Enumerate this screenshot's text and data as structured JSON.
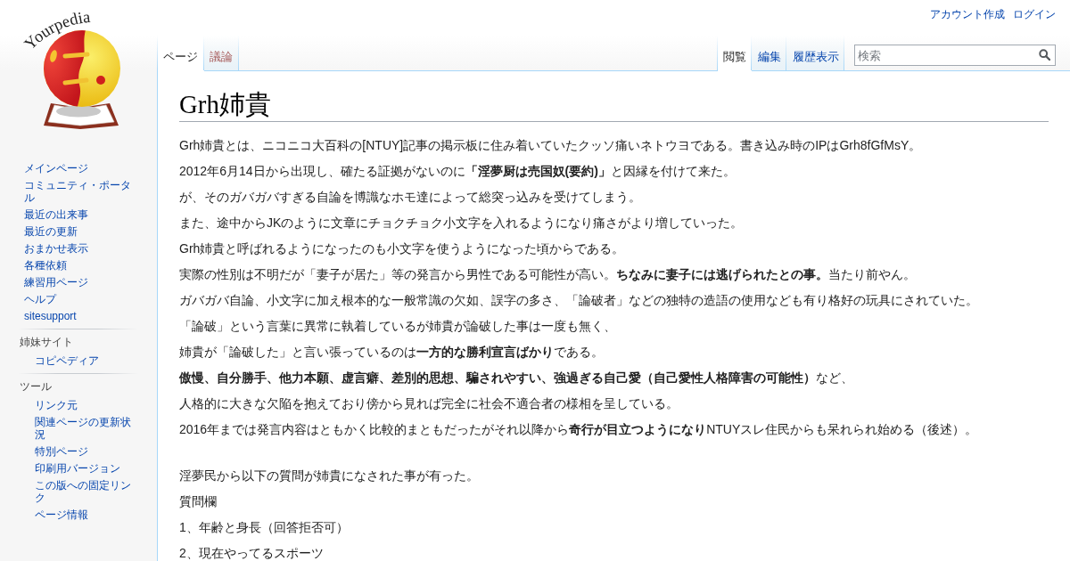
{
  "personal_links": [
    "アカウント作成",
    "ログイン"
  ],
  "logo": {
    "text": "Yourpedia"
  },
  "sidebar": {
    "navigation": [
      "メインページ",
      "コミュニティ・ポータル",
      "最近の出来事",
      "最近の更新",
      "おまかせ表示",
      "各種依頼",
      "練習用ページ",
      "ヘルプ",
      "sitesupport"
    ],
    "portals": [
      {
        "heading": "姉妹サイト",
        "items": [
          "コピペディア"
        ]
      },
      {
        "heading": "ツール",
        "items": [
          "リンク元",
          "関連ページの更新状況",
          "特別ページ",
          "印刷用バージョン",
          "この版への固定リンク",
          "ページ情報"
        ]
      }
    ]
  },
  "namespace_tabs": [
    {
      "label": "ページ",
      "selected": true,
      "missing": false
    },
    {
      "label": "議論",
      "selected": false,
      "missing": true
    }
  ],
  "view_tabs": [
    {
      "label": "閲覧",
      "selected": true
    },
    {
      "label": "編集",
      "selected": false
    },
    {
      "label": "履歴表示",
      "selected": false
    }
  ],
  "search": {
    "placeholder": "検索"
  },
  "article": {
    "title": "Grh姉貴",
    "blocks": [
      {
        "lines": [
          "Grh姉貴とは、ニコニコ大百科の[NTUY]記事の掲示板に住み着いていたクッソ痛いネトウヨである。書き込み時のIPはGrh8fGfMsY。",
          "2012年6月14日から出現し、確たる証拠がないのに**「淫夢厨は売国奴(要約)」**と因縁を付けて来た。",
          "が、そのガバガバすぎる自論を博識なホモ達によって総突っ込みを受けてしまう。",
          "また、途中からJKのように文章にチョクチョク小文字を入れるようになり痛さがより増していった。",
          "Grh姉貴と呼ばれるようになったのも小文字を使うようになった頃からである。",
          "実際の性別は不明だが「妻子が居た」等の発言から男性である可能性が高い。**ちなみに妻子には逃げられたとの事。**当たり前やん。",
          "ガバガバ自論、小文字に加え根本的な一般常識の欠如、誤字の多さ、「論破者」などの独特の造語の使用なども有り格好の玩具にされていた。",
          "「論破」という言葉に異常に執着しているが姉貴が論破した事は一度も無く、",
          "姉貴が「論破した」と言い張っているのは**一方的な勝利宣言ばかり**である。",
          "**傲慢、自分勝手、他力本願、虚言癖、差別的思想、騙されやすい、強過ぎる自己愛（自己愛性人格障害の可能性）**など、",
          "人格的に大きな欠陥を抱えており傍から見れば完全に社会不適合者の様相を呈している。",
          "2016年までは発言内容はともかく比較的まともだったがそれ以降から**奇行が目立つようになり**NTUYスレ住民からも呆れられ始める（後述）。"
        ]
      },
      {
        "lines": [
          "淫夢民から以下の質問が姉貴になされた事が有った。",
          "質問欄",
          "1、年齢と身長（回答拒否可）",
          "2、現在やってるスポーツ"
        ]
      }
    ]
  }
}
